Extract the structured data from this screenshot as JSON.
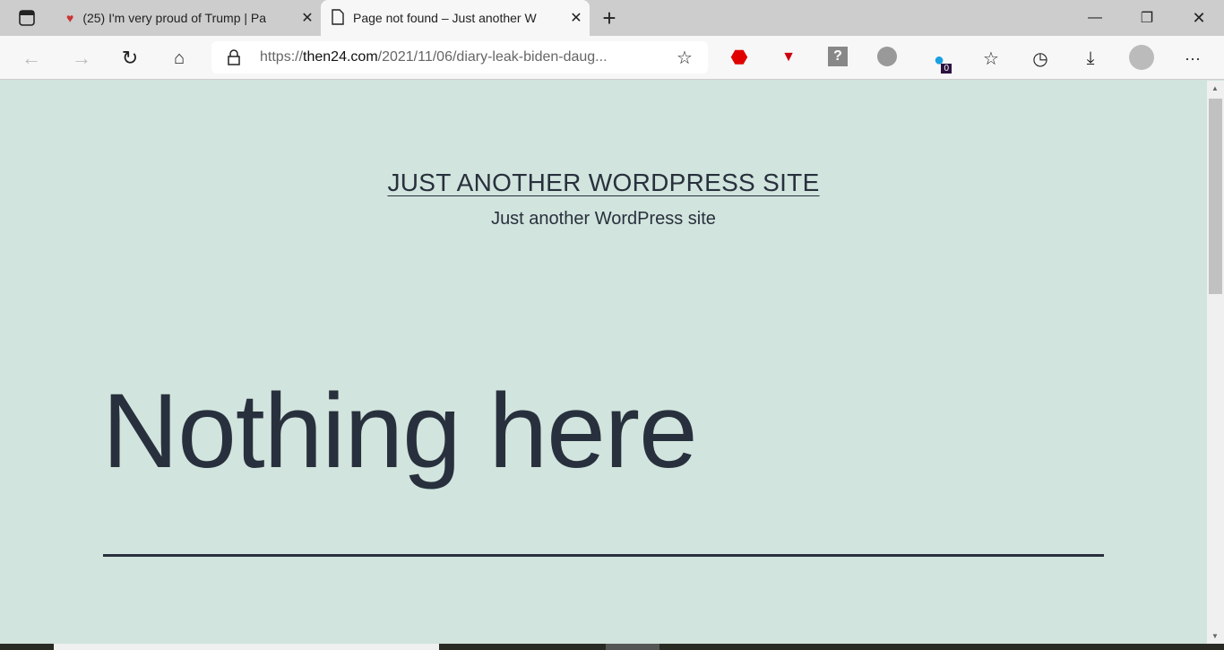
{
  "browser": {
    "tabs": [
      {
        "title": "(25) I'm very proud of Trump | Pa",
        "active": false
      },
      {
        "title": "Page not found – Just another W",
        "active": true
      }
    ],
    "address": {
      "prefix": "https://",
      "domain": "then24.com",
      "path": "/2021/11/06/diary-leak-biden-daug..."
    },
    "extension_badge": "0"
  },
  "page": {
    "site_title": "JUST ANOTHER WORDPRESS SITE",
    "tagline": "Just another WordPress site",
    "heading": "Nothing here"
  }
}
